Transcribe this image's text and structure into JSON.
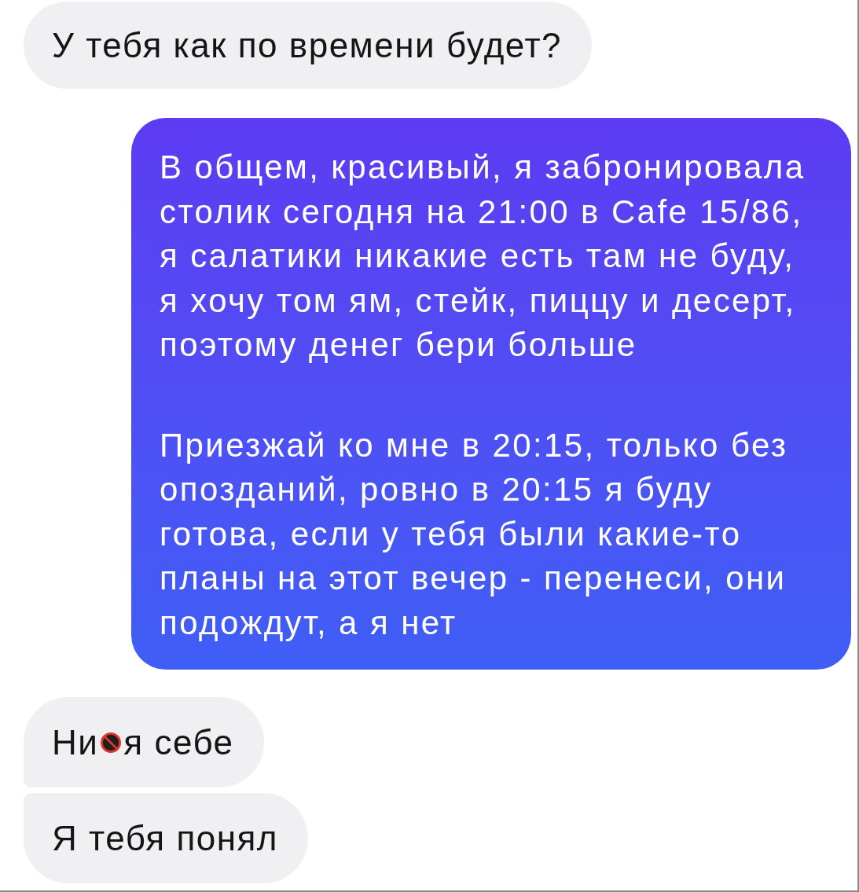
{
  "messages": [
    {
      "kind": "received",
      "joined_above": false,
      "joined_below": false,
      "parts": [
        {
          "kind": "text",
          "text": "У тебя как по времени будет?"
        }
      ]
    },
    {
      "kind": "sent",
      "paragraphs": [
        "В общем, красивый, я забронировала\nстолик сегодня на 21:00 в Cafe 15/86,\nя салатики никакие есть там не буду,\nя хочу том ям, стейк, пиццу и десерт,\nпоэтому денег бери больше",
        "Приезжай ко мне в 20:15, только без\nопозданий, ровно в 20:15 я буду\nготова, если у тебя были какие-то\nпланы на этот вечер - перенеси, они\nподождут, а я нет"
      ]
    },
    {
      "kind": "received",
      "joined_above": false,
      "joined_below": true,
      "parts": [
        {
          "kind": "text",
          "text": "Ни"
        },
        {
          "kind": "sticker"
        },
        {
          "kind": "text",
          "text": "я себе"
        }
      ]
    },
    {
      "kind": "received",
      "joined_above": true,
      "joined_below": false,
      "parts": [
        {
          "kind": "text",
          "text": "Я тебя понял"
        }
      ]
    }
  ]
}
